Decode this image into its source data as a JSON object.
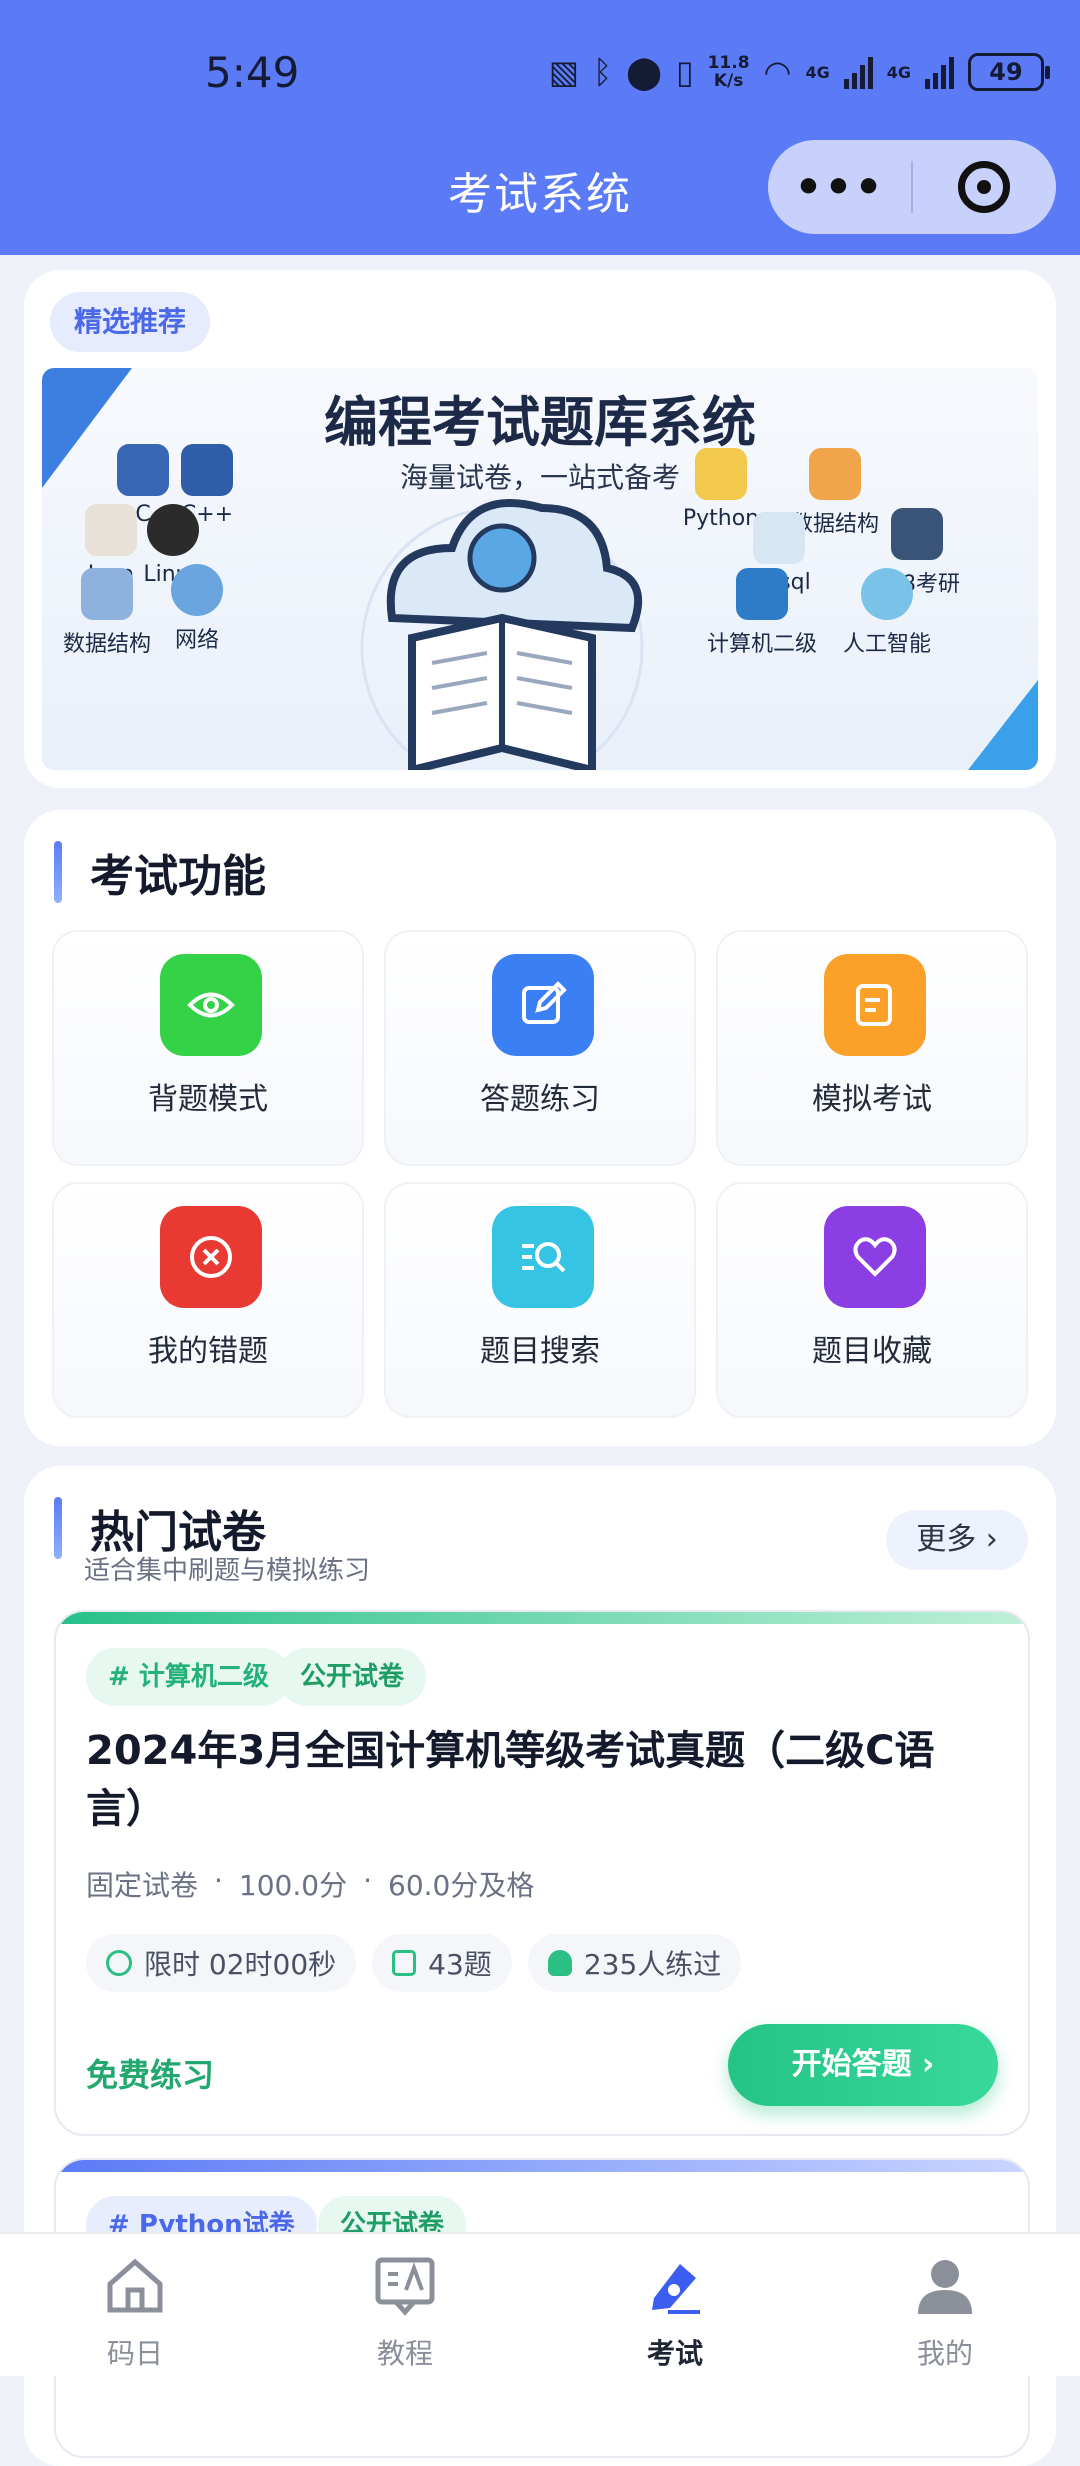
{
  "status_bar": {
    "time": "5:49",
    "net_speed_top": "11.8",
    "net_speed_bottom": "K/s",
    "sig1": "4G",
    "sig2": "4G",
    "battery": "49"
  },
  "nav": {
    "title": "考试系统",
    "more_glyph": "•••"
  },
  "banner": {
    "pill": "精选推荐",
    "title": "编程考试题库系统",
    "subtitle": "海量试卷，一站式备考",
    "tech_left": [
      "C",
      "C++",
      "Java",
      "Linux",
      "数据结构",
      "网络"
    ],
    "tech_right": [
      "Python",
      "数据结构",
      "Mysql",
      "408考研",
      "计算机二级",
      "人工智能"
    ]
  },
  "functions": {
    "title": "考试功能",
    "items": [
      {
        "label": "背题模式",
        "icon": "eye-icon",
        "color": "#34d246"
      },
      {
        "label": "答题练习",
        "icon": "edit-icon",
        "color": "#3b7ff5"
      },
      {
        "label": "模拟考试",
        "icon": "note-icon",
        "color": "#fba028"
      },
      {
        "label": "我的错题",
        "icon": "x-circle-icon",
        "color": "#e83a33"
      },
      {
        "label": "题目搜索",
        "icon": "search-list-icon",
        "color": "#36c4e4"
      },
      {
        "label": "题目收藏",
        "icon": "heart-icon",
        "color": "#8a3ee3"
      }
    ]
  },
  "hot": {
    "title": "热门试卷",
    "subtitle": "适合集中刷题与模拟练习",
    "more": "更多",
    "papers": [
      {
        "tag": "# 计算机二级",
        "public": "公开试卷",
        "title": "2024年3月全国计算机等级考试真题（二级C语言）",
        "meta": [
          "固定试卷",
          "·",
          "100.0分",
          "·",
          "60.0分及格"
        ],
        "time_limit": "限时 02时00秒",
        "questions": "43题",
        "practiced": "235人练过",
        "free_label": "免费练习",
        "start": "开始答题"
      },
      {
        "tag": "# Python试卷",
        "public": "公开试卷"
      }
    ]
  },
  "tabs": [
    {
      "label": "码日",
      "icon": "home-icon"
    },
    {
      "label": "教程",
      "icon": "tutorial-icon"
    },
    {
      "label": "考试",
      "icon": "pen-icon"
    },
    {
      "label": "我的",
      "icon": "user-icon"
    }
  ],
  "active_tab": "考试"
}
